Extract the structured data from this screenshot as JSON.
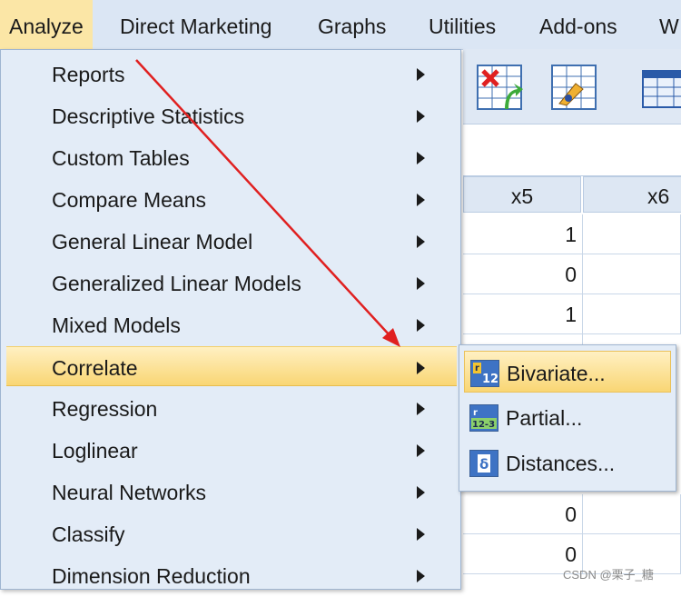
{
  "menubar": {
    "items": [
      {
        "label": "Analyze",
        "active": true
      },
      {
        "label": "Direct Marketing"
      },
      {
        "label": "Graphs"
      },
      {
        "label": "Utilities"
      },
      {
        "label": "Add-ons"
      },
      {
        "label": "W"
      }
    ]
  },
  "analyze_menu": {
    "items": [
      {
        "label": "Reports"
      },
      {
        "label": "Descriptive Statistics"
      },
      {
        "label": "Custom Tables"
      },
      {
        "label": "Compare Means"
      },
      {
        "label": "General Linear Model"
      },
      {
        "label": "Generalized Linear Models"
      },
      {
        "label": "Mixed Models"
      },
      {
        "label": "Correlate",
        "highlighted": true
      },
      {
        "label": "Regression"
      },
      {
        "label": "Loglinear"
      },
      {
        "label": "Neural Networks"
      },
      {
        "label": "Classify"
      },
      {
        "label": "Dimension Reduction"
      }
    ]
  },
  "correlate_submenu": {
    "items": [
      {
        "label": "Bivariate...",
        "icon": "bivariate-icon",
        "icon_text": "12",
        "highlighted": true
      },
      {
        "label": "Partial...",
        "icon": "partial-icon",
        "icon_text": "12-3"
      },
      {
        "label": "Distances...",
        "icon": "distances-icon",
        "icon_text": "δ"
      }
    ]
  },
  "grid": {
    "columns": [
      "x5",
      "x6"
    ],
    "x5_values": [
      "1",
      "0",
      "1",
      "",
      "",
      "",
      "",
      "0",
      "0",
      ""
    ]
  },
  "watermark": "CSDN @栗子_糖",
  "colors": {
    "menubar_bg": "#dbe6f4",
    "active_menu_bg": "#fbe6a6",
    "menu_bg": "#e3ecf7",
    "highlight": "#f9d674",
    "arrow": "#e02020"
  }
}
